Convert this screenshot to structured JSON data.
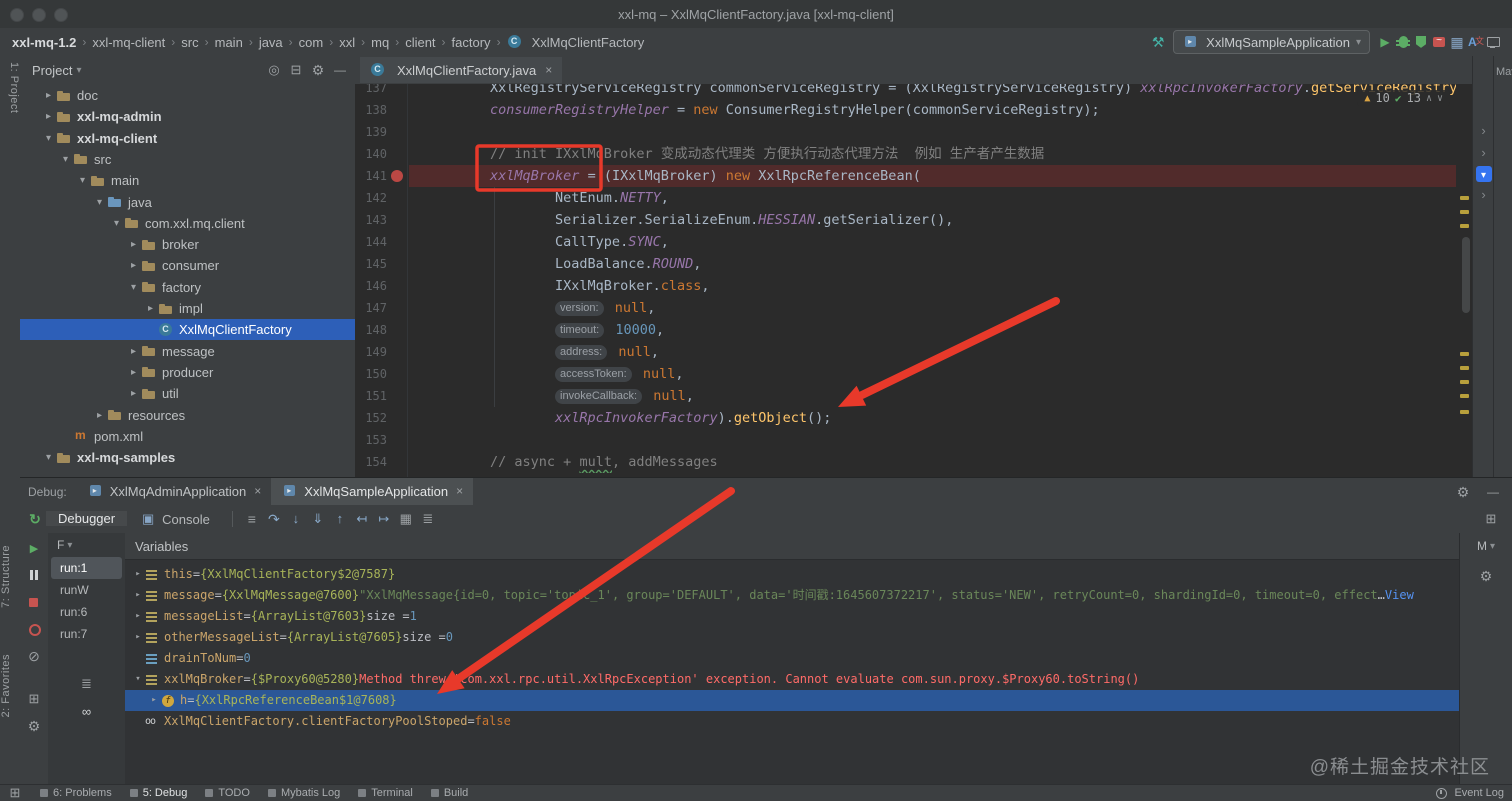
{
  "window": {
    "title": "xxl-mq – XxlMqClientFactory.java [xxl-mq-client]"
  },
  "nav": {
    "breadcrumbs": [
      "xxl-mq-1.2",
      "xxl-mq-client",
      "src",
      "main",
      "java",
      "com",
      "xxl",
      "mq",
      "client",
      "factory",
      "XxlMqClientFactory"
    ],
    "run_config": "XxlMqSampleApplication",
    "icons_before_config": [
      "wrench"
    ],
    "icons_after_config": [
      "play",
      "debug-bug",
      "coverage",
      "profiler",
      "grid",
      "translate",
      "monitor"
    ]
  },
  "left_strip": {
    "top": "1: Project",
    "structure": "7: Structure",
    "favorites": "2: Favorites"
  },
  "right_strip": {
    "label": "Maven",
    "icons": [
      "chevron",
      "chevron",
      "highlighted-tool",
      "chevron"
    ]
  },
  "project": {
    "title": "Project",
    "header_icons": [
      "locate",
      "collapse-all",
      "settings",
      "hide"
    ],
    "tree": [
      {
        "depth": 1,
        "arrow": "collapsed",
        "icon": "folder",
        "label": "doc"
      },
      {
        "depth": 1,
        "arrow": "collapsed",
        "icon": "module",
        "label": "xxl-mq-admin",
        "bold": true
      },
      {
        "depth": 1,
        "arrow": "expanded",
        "icon": "module",
        "label": "xxl-mq-client",
        "bold": true
      },
      {
        "depth": 2,
        "arrow": "expanded",
        "icon": "folder",
        "label": "src"
      },
      {
        "depth": 3,
        "arrow": "expanded",
        "icon": "folder",
        "label": "main"
      },
      {
        "depth": 4,
        "arrow": "expanded",
        "icon": "source-folder",
        "label": "java"
      },
      {
        "depth": 5,
        "arrow": "expanded",
        "icon": "package",
        "label": "com.xxl.mq.client"
      },
      {
        "depth": 6,
        "arrow": "collapsed",
        "icon": "package",
        "label": "broker"
      },
      {
        "depth": 6,
        "arrow": "collapsed",
        "icon": "package",
        "label": "consumer"
      },
      {
        "depth": 6,
        "arrow": "expanded",
        "icon": "package",
        "label": "factory"
      },
      {
        "depth": 7,
        "arrow": "collapsed",
        "icon": "package",
        "label": "impl"
      },
      {
        "depth": 7,
        "icon": "class",
        "label": "XxlMqClientFactory",
        "selected": true
      },
      {
        "depth": 6,
        "arrow": "collapsed",
        "icon": "package",
        "label": "message"
      },
      {
        "depth": 6,
        "arrow": "collapsed",
        "icon": "package",
        "label": "producer"
      },
      {
        "depth": 6,
        "arrow": "collapsed",
        "icon": "package",
        "label": "util"
      },
      {
        "depth": 4,
        "arrow": "collapsed",
        "icon": "resources",
        "label": "resources"
      },
      {
        "depth": 2,
        "icon": "maven",
        "label": "pom.xml"
      },
      {
        "depth": 1,
        "arrow": "expanded",
        "icon": "module",
        "label": "xxl-mq-samples",
        "bold": true
      }
    ]
  },
  "editor": {
    "tab": {
      "label": "XxlMqClientFactory.java"
    },
    "inspections": {
      "warnings": "10",
      "passed": "13"
    },
    "lines": [
      {
        "n": 137,
        "seg": [
          [
            "p",
            "        XxlRegistryServiceRegistry commonServiceRegistry = (XxlRegistryServiceRegistry) "
          ],
          [
            "f",
            "xxlRpcInvokerFactory"
          ],
          [
            "p",
            "."
          ],
          [
            "m",
            "getServiceRegistry"
          ],
          [
            "p",
            "();"
          ]
        ]
      },
      {
        "n": 138,
        "seg": [
          [
            "p",
            "        "
          ],
          [
            "f",
            "consumerRegistryHelper"
          ],
          [
            "p",
            " = "
          ],
          [
            "k",
            "new"
          ],
          [
            "p",
            " ConsumerRegistryHelper(commonServiceRegistry);"
          ]
        ]
      },
      {
        "n": 139,
        "seg": []
      },
      {
        "n": 140,
        "seg": [
          [
            "c1",
            "        // init IXxlMqBroker 变成动态代理类 方便执行动态代理方法  例如 生产者产生数据"
          ]
        ]
      },
      {
        "n": 141,
        "bp": true,
        "exec": true,
        "seg": [
          [
            "p",
            "        "
          ],
          [
            "f",
            "xxlMqBroker"
          ],
          [
            "p",
            " = (IXxlMqBroker) "
          ],
          [
            "k",
            "new"
          ],
          [
            "p",
            " XxlRpcReferenceBean("
          ]
        ]
      },
      {
        "n": 142,
        "seg": [
          [
            "p",
            "                NetEnum."
          ],
          [
            "cf",
            "NETTY"
          ],
          [
            "p",
            ","
          ]
        ]
      },
      {
        "n": 143,
        "seg": [
          [
            "p",
            "                Serializer.SerializeEnum."
          ],
          [
            "cf",
            "HESSIAN"
          ],
          [
            "p",
            ".getSerializer(),"
          ]
        ]
      },
      {
        "n": 144,
        "seg": [
          [
            "p",
            "                CallType."
          ],
          [
            "cf",
            "SYNC"
          ],
          [
            "p",
            ","
          ]
        ]
      },
      {
        "n": 145,
        "seg": [
          [
            "p",
            "                LoadBalance."
          ],
          [
            "cf",
            "ROUND"
          ],
          [
            "p",
            ","
          ]
        ]
      },
      {
        "n": 146,
        "seg": [
          [
            "p",
            "                IXxlMqBroker."
          ],
          [
            "k",
            "class"
          ],
          [
            "p",
            ","
          ]
        ]
      },
      {
        "n": 147,
        "seg": [
          [
            "p",
            "                "
          ],
          [
            "h",
            "version:"
          ],
          [
            "p",
            " "
          ],
          [
            "k",
            "null"
          ],
          [
            "p",
            ","
          ]
        ]
      },
      {
        "n": 148,
        "seg": [
          [
            "p",
            "                "
          ],
          [
            "h",
            "timeout:"
          ],
          [
            "p",
            " "
          ],
          [
            "n2",
            "10000"
          ],
          [
            "p",
            ","
          ]
        ]
      },
      {
        "n": 149,
        "seg": [
          [
            "p",
            "                "
          ],
          [
            "h",
            "address:"
          ],
          [
            "p",
            " "
          ],
          [
            "k",
            "null"
          ],
          [
            "p",
            ","
          ]
        ]
      },
      {
        "n": 150,
        "seg": [
          [
            "p",
            "                "
          ],
          [
            "h",
            "accessToken:"
          ],
          [
            "p",
            " "
          ],
          [
            "k",
            "null"
          ],
          [
            "p",
            ","
          ]
        ]
      },
      {
        "n": 151,
        "seg": [
          [
            "p",
            "                "
          ],
          [
            "h",
            "invokeCallback:"
          ],
          [
            "p",
            " "
          ],
          [
            "k",
            "null"
          ],
          [
            "p",
            ","
          ]
        ]
      },
      {
        "n": 152,
        "seg": [
          [
            "p",
            "                "
          ],
          [
            "f",
            "xxlRpcInvokerFactory"
          ],
          [
            "p",
            ")."
          ],
          [
            "m",
            "getObject"
          ],
          [
            "p",
            "();"
          ]
        ]
      },
      {
        "n": 153,
        "seg": []
      },
      {
        "n": 154,
        "seg": [
          [
            "c1",
            "        // async + "
          ],
          [
            "cw",
            "mult"
          ],
          [
            "c1",
            ", addMessages"
          ]
        ]
      }
    ]
  },
  "debug": {
    "label": "Debug:",
    "tabs": [
      {
        "label": "XxlMqAdminApplication"
      },
      {
        "label": "XxlMqSampleApplication",
        "selected": true
      }
    ],
    "tabs_right_icons": [
      "settings",
      "minimize"
    ],
    "toolbar": {
      "rerun_icons": [
        "rerun"
      ],
      "views": [
        {
          "label": "Debugger",
          "selected": true
        },
        {
          "label": "Console",
          "icon": "console"
        }
      ],
      "icons": [
        "layout",
        "step-over",
        "step-into",
        "force-step-into",
        "step-out",
        "drop-frame",
        "run-to-cursor",
        "view-table",
        "threads-view"
      ],
      "right_icons": [
        "restore-layout"
      ]
    },
    "left_icons": [
      "resume",
      "pause",
      "stop",
      "view-breakpoints",
      "mute-breakpoints",
      "restore-layout",
      "settings"
    ],
    "frames": {
      "filter_label": "F",
      "threads": [
        {
          "label": "run:1",
          "selected": true
        },
        {
          "label": "runW"
        },
        {
          "label": "run:6"
        },
        {
          "label": "run:7"
        }
      ],
      "bottom_icons": [
        "bookmarks",
        "watches"
      ]
    },
    "variables_title": "Variables",
    "memory_label": "M",
    "variables": [
      {
        "arrow": "collapsed",
        "icon": "value",
        "depth": 0,
        "seg": [
          [
            "nm",
            "this"
          ],
          [
            "pl",
            " = "
          ],
          [
            "rf",
            "{XxlMqClientFactory$2@7587}"
          ]
        ]
      },
      {
        "arrow": "collapsed",
        "icon": "value",
        "depth": 0,
        "seg": [
          [
            "nm",
            "message"
          ],
          [
            "pl",
            " = "
          ],
          [
            "rf",
            "{XxlMqMessage@7600} "
          ],
          [
            "st",
            "\"XxlMqMessage{id=0, topic='topic_1', group='DEFAULT', data='时间戳:1645607372217', status='NEW', retryCount=0, shardingId=0, timeout=0, effect"
          ],
          [
            "pl",
            "… "
          ],
          [
            "ln",
            "View"
          ]
        ]
      },
      {
        "arrow": "collapsed",
        "icon": "value",
        "depth": 0,
        "seg": [
          [
            "nm",
            "messageList"
          ],
          [
            "pl",
            " = "
          ],
          [
            "rf",
            "{ArrayList@7603}"
          ],
          [
            "pl",
            " size = "
          ],
          [
            "nu",
            "1"
          ]
        ]
      },
      {
        "arrow": "collapsed",
        "icon": "value",
        "depth": 0,
        "seg": [
          [
            "nm",
            "otherMessageList"
          ],
          [
            "pl",
            " = "
          ],
          [
            "rf",
            "{ArrayList@7605}"
          ],
          [
            "pl",
            " size = "
          ],
          [
            "nu",
            "0"
          ]
        ]
      },
      {
        "icon": "primitive",
        "depth": 0,
        "seg": [
          [
            "nm",
            "drainToNum"
          ],
          [
            "pl",
            " = "
          ],
          [
            "nu",
            "0"
          ]
        ]
      },
      {
        "arrow": "expanded",
        "icon": "value",
        "depth": 0,
        "seg": [
          [
            "nm",
            "xxlMqBroker"
          ],
          [
            "pl",
            " = "
          ],
          [
            "rf",
            "{$Proxy60@5280}"
          ],
          [
            "er",
            " Method threw 'com.xxl.rpc.util.XxlRpcException' exception. Cannot evaluate com.sun.proxy.$Proxy60.toString()"
          ]
        ]
      },
      {
        "arrow": "collapsed",
        "icon": "field",
        "depth": 1,
        "selected": true,
        "seg": [
          [
            "nm",
            "h"
          ],
          [
            "pl",
            " = "
          ],
          [
            "rf",
            "{XxlRpcReferenceBean$1@7608}"
          ]
        ]
      },
      {
        "icon": "static",
        "depth": 0,
        "seg": [
          [
            "nm",
            "XxlMqClientFactory.clientFactoryPoolStoped"
          ],
          [
            "pl",
            " = "
          ],
          [
            "kw",
            "false"
          ]
        ]
      }
    ]
  },
  "status": {
    "left": [
      "6: Problems",
      "5: Debug",
      "TODO",
      "Mybatis Log",
      "Terminal",
      "Build"
    ],
    "right": [
      "Event Log"
    ]
  },
  "watermark": "@稀土掘金技术社区",
  "annotations": [
    {
      "type": "box",
      "target": "xxlMqBroker assignment"
    },
    {
      "type": "arrow",
      "target": "xxlRpcInvokerFactory).getObject() line"
    },
    {
      "type": "arrow",
      "target": "variable h = {XxlRpcReferenceBean$1@7608}"
    }
  ],
  "colors": {
    "editor_bg": "#2b2b2b",
    "panel_bg": "#3c3f41",
    "breakpoint_line": "#512b2b",
    "annotation_red": "#e8392a",
    "selection_project": "#2d5fb8",
    "selection_debug": "#2b5797"
  }
}
